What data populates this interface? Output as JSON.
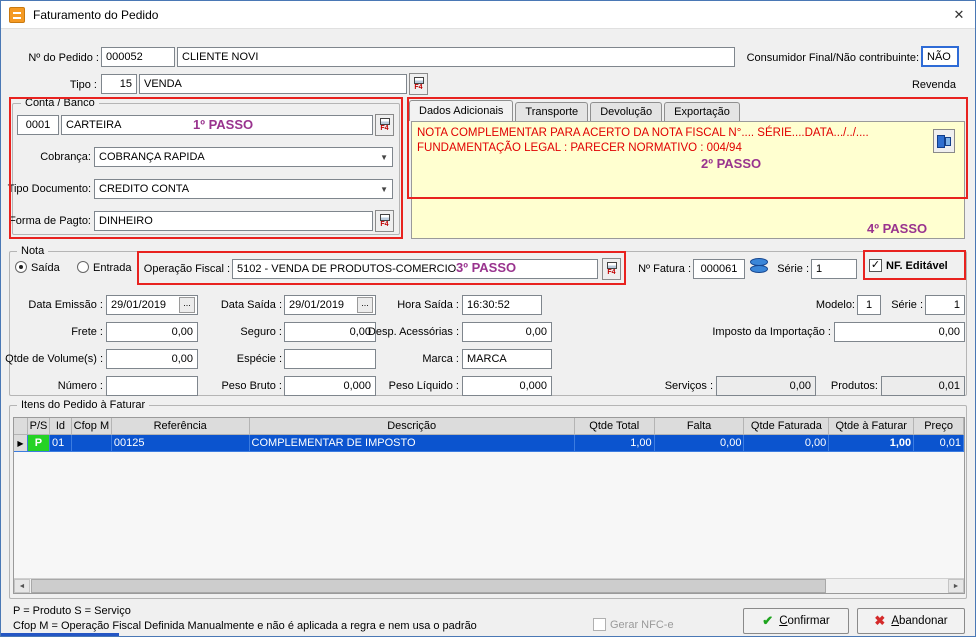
{
  "window": {
    "title": "Faturamento do Pedido"
  },
  "icons": {
    "close": "✕",
    "combo_arrow": "▼",
    "check": "✓",
    "confirm": "✔",
    "abandon": "✖",
    "row_marker": "▶",
    "scroll_left": "◄",
    "scroll_right": "►",
    "f4": "F4",
    "ellipsis": "..."
  },
  "header": {
    "pedido_label": "Nº do Pedido :",
    "pedido_value": "000052",
    "cliente_value": "CLIENTE NOVI",
    "consumidor_label": "Consumidor Final/Não contribuinte:",
    "consumidor_value": "NÃO",
    "tipo_label": "Tipo :",
    "tipo_code": "15",
    "tipo_value": "VENDA",
    "revenda_label": "Revenda"
  },
  "conta_banco": {
    "title": "Conta / Banco",
    "conta_code": "0001",
    "conta_value": "CARTEIRA",
    "passo1": "1º PASSO",
    "cobranca_label": "Cobrança:",
    "cobranca_value": "COBRANÇA RAPIDA",
    "tipo_documento_label": "Tipo Documento:",
    "tipo_documento_value": "CREDITO CONTA",
    "forma_pagto_label": "Forma de Pagto:",
    "forma_pagto_value": "DINHEIRO"
  },
  "adicionais": {
    "tabs": [
      "Dados Adicionais",
      "Transporte",
      "Devolução",
      "Exportação"
    ],
    "memo_line1": "NOTA COMPLEMENTAR PARA ACERTO DA NOTA FISCAL N°.... SÉRIE....DATA.../../....",
    "memo_line2": "FUNDAMENTAÇÃO LEGAL : PARECER NORMATIVO : 004/94",
    "passo2": "2º PASSO",
    "passo4": "4º PASSO"
  },
  "nota": {
    "title": "Nota",
    "saida_label": "Saída",
    "entrada_label": "Entrada",
    "operacao_label": "Operação Fiscal :",
    "operacao_value": "5102 - VENDA DE PRODUTOS-COMERCIO",
    "passo3": "3º PASSO",
    "fatura_label": "Nº Fatura :",
    "fatura_value": "000061",
    "serie_label": "Série :",
    "serie_value": "1",
    "nf_editavel_label": "NF. Editável",
    "data_emissao_label": "Data Emissão :",
    "data_emissao_value": "29/01/2019",
    "data_saida_label": "Data Saída :",
    "data_saida_value": "29/01/2019",
    "hora_saida_label": "Hora Saída :",
    "hora_saida_value": "16:30:52",
    "modelo_label": "Modelo:",
    "modelo_value": "1",
    "serie2_label": "Série :",
    "serie2_value": "1",
    "frete_label": "Frete :",
    "frete_value": "0,00",
    "seguro_label": "Seguro :",
    "seguro_value": "0,00",
    "desp_label": "Desp. Acessórias :",
    "desp_value": "0,00",
    "imposto_label": "Imposto da Importação :",
    "imposto_value": "0,00",
    "qtde_vol_label": "Qtde de Volume(s) :",
    "qtde_vol_value": "0,00",
    "especie_label": "Espécie :",
    "especie_value": "",
    "marca_label": "Marca :",
    "marca_value": "MARCA",
    "numero_label": "Número :",
    "numero_value": "",
    "peso_bruto_label": "Peso Bruto :",
    "peso_bruto_value": "0,000",
    "peso_liquido_label": "Peso Líquido :",
    "peso_liquido_value": "0,000",
    "servicos_label": "Serviços :",
    "servicos_value": "0,00",
    "produtos_label": "Produtos:",
    "produtos_value": "0,01"
  },
  "itens": {
    "title": "Itens do Pedido à Faturar",
    "headers": [
      "P/S",
      "Id",
      "Cfop M",
      "Referência",
      "Descrição",
      "Qtde Total",
      "Falta",
      "Qtde Faturada",
      "Qtde à Faturar",
      "Preço"
    ],
    "row": {
      "ps": "P",
      "id": "01",
      "cfop_m": "",
      "referencia": "00125",
      "descricao": "COMPLEMENTAR DE IMPOSTO",
      "qtde_total": "1,00",
      "falta": "0,00",
      "qtde_faturada": "0,00",
      "qtde_a_faturar": "1,00",
      "preco": "0,01"
    }
  },
  "footer": {
    "legend1": "P = Produto S = Serviço",
    "legend2": "Cfop M = Operação Fiscal Definida Manualmente e não é aplicada a regra e nem usa o padrão",
    "gerar_nfce_label": "Gerar NFC-e",
    "confirmar_label": "Confirmar",
    "abandonar_label": "Abandonar"
  },
  "colors": {
    "highlight_red": "#e8221f",
    "passo_purple": "#99338e",
    "memo_bg": "#ffffd0",
    "memo_text": "#e00000",
    "selected_row_blue": "#0b54cf",
    "product_green": "#25d325",
    "consumidor_border_blue": "#2e6bd6",
    "titlebar_icon_orange": "#f59a23"
  }
}
